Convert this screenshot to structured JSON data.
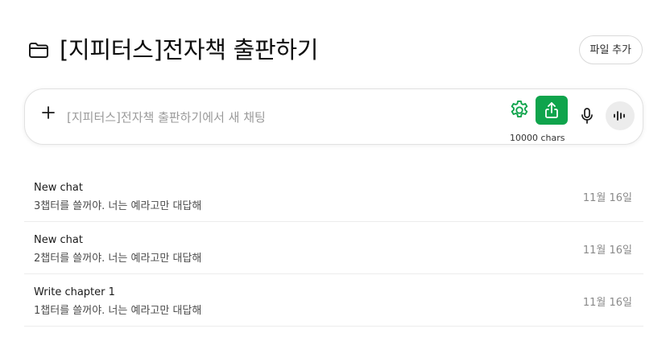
{
  "header": {
    "title": "[지피터스]전자책 출판하기",
    "folder_icon": "folder-icon",
    "add_file_label": "파일 추가"
  },
  "composer": {
    "placeholder": "[지피터스]전자책 출판하기에서 새 채팅",
    "value": "",
    "chars_label": "10000 chars",
    "plus_icon": "plus-icon",
    "gear_icon": "gear-icon",
    "share_icon": "share-icon",
    "mic_icon": "mic-icon",
    "voice_icon": "voice-waveform-icon",
    "accent_color": "#0fa44c"
  },
  "chats": [
    {
      "title": "New chat",
      "preview": "3챕터를 쓸꺼야. 너는 예라고만 대답해",
      "date": "11월 16일"
    },
    {
      "title": "New chat",
      "preview": "2챕터를 쓸꺼야. 너는 예라고만 대답해",
      "date": "11월 16일"
    },
    {
      "title": "Write chapter 1",
      "preview": "1챕터를 쓸꺼야. 너는 예라고만 대답해",
      "date": "11월 16일"
    }
  ]
}
